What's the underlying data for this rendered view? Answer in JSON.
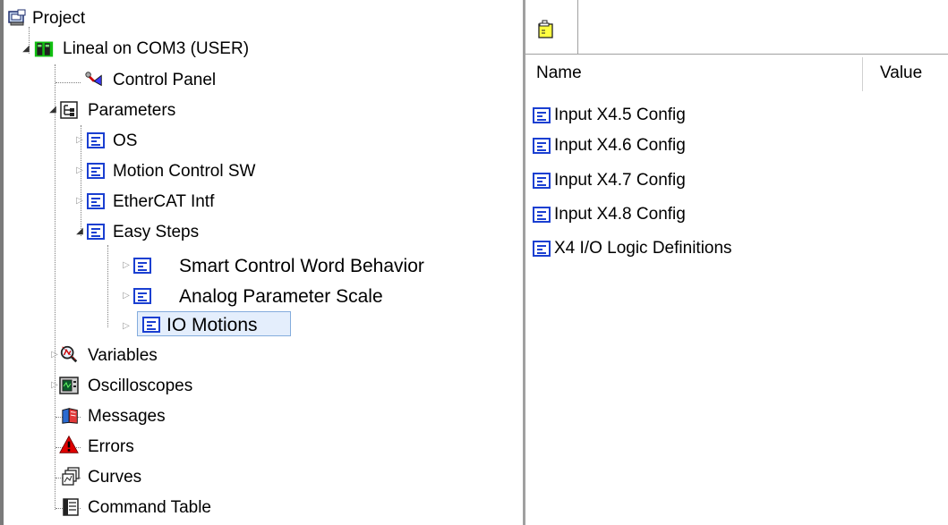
{
  "tree": {
    "project": "Project",
    "device": "Lineal on COM3 (USER)",
    "control_panel": "Control Panel",
    "parameters": "Parameters",
    "os": "OS",
    "motion_control_sw": "Motion Control SW",
    "ethercat_intf": "EtherCAT Intf",
    "easy_steps": "Easy Steps",
    "smart_control_word": "Smart Control Word Behavior",
    "analog_parameter_scale": "Analog Parameter Scale",
    "io_motions": "IO Motions",
    "variables": "Variables",
    "oscilloscopes": "Oscilloscopes",
    "messages": "Messages",
    "errors": "Errors",
    "curves": "Curves",
    "command_table": "Command Table"
  },
  "list": {
    "col_name": "Name",
    "col_value": "Value",
    "items": [
      "Input X4.5 Config",
      "Input X4.6 Config",
      "Input X4.7 Config",
      "Input X4.8 Config",
      "X4 I/O Logic Definitions"
    ]
  },
  "colors": {
    "selection_bg": "#e4eefc",
    "selection_border": "#84acdd",
    "doc_icon": "#1a3fd1"
  }
}
